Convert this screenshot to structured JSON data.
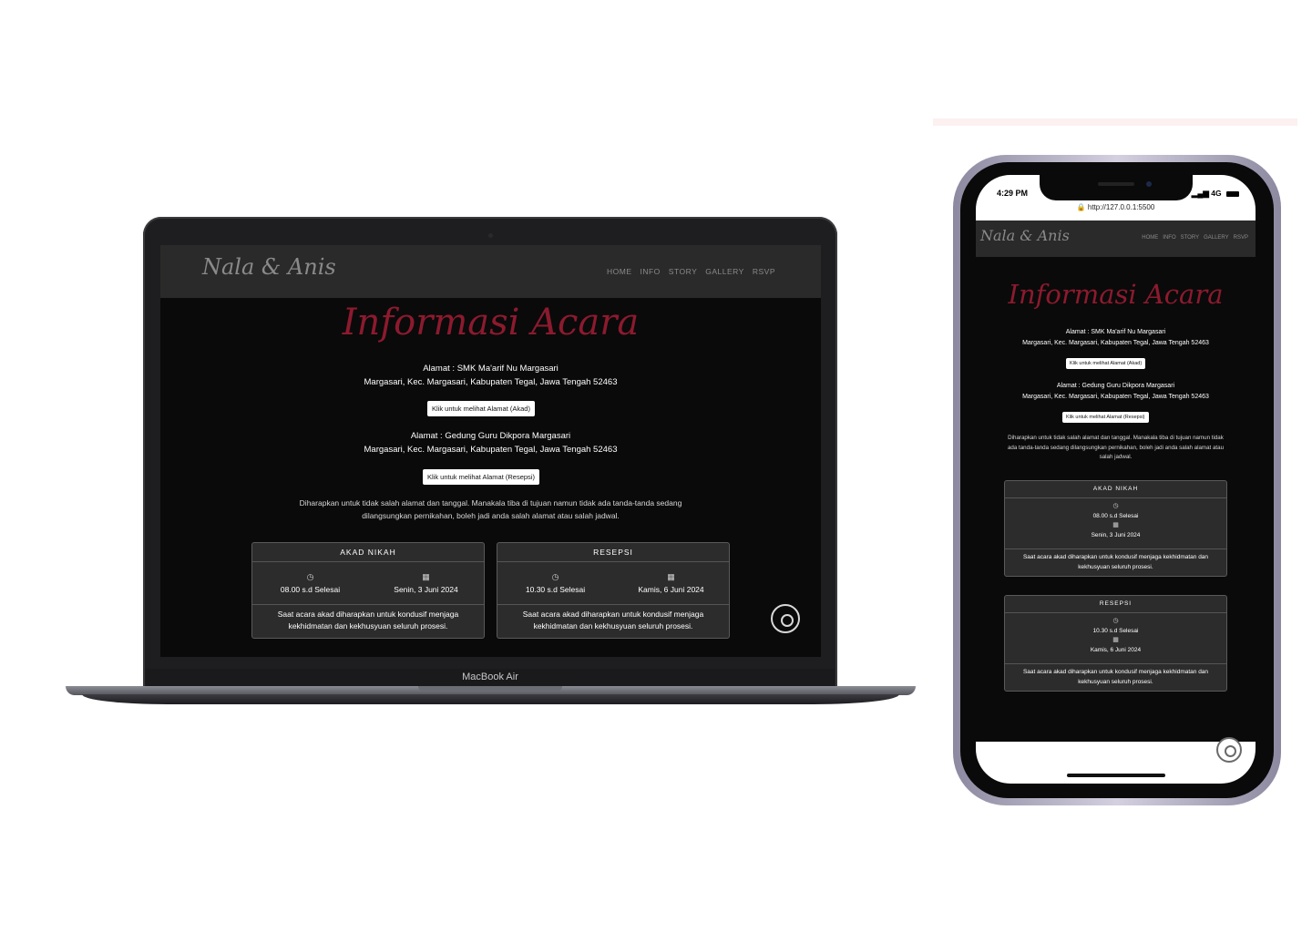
{
  "site": {
    "logo": "Nala & Anis",
    "nav": [
      "HOME",
      "INFO",
      "STORY",
      "GALLERY",
      "RSVP"
    ],
    "title": "Informasi Acara",
    "akad_address_line1": "Alamat : SMK Ma'arif Nu Margasari",
    "akad_address_line2": "Margasari, Kec. Margasari, Kabupaten Tegal, Jawa Tengah 52463",
    "akad_button": "Klik untuk melihat Alamat (Akad)",
    "resepsi_address_line1": "Alamat : Gedung Guru Dikpora Margasari",
    "resepsi_address_line2": "Margasari, Kec. Margasari, Kabupaten Tegal, Jawa Tengah 52463",
    "resepsi_button": "Klik untuk melihat Alamat (Resepsi)",
    "note": "Diharapkan untuk tidak salah alamat dan tanggal. Manakala tiba di tujuan namun tidak ada tanda-tanda sedang dilangsungkan pernikahan, boleh jadi anda salah alamat atau salah jadwal.",
    "cards": [
      {
        "title": "AKAD NIKAH",
        "time": "08.00 s.d Selesai",
        "date": "Senin, 3 Juni 2024",
        "desc": "Saat acara akad diharapkan untuk kondusif menjaga kekhidmatan dan kekhusyuan seluruh prosesi."
      },
      {
        "title": "RESEPSI",
        "time": "10.30 s.d Selesai",
        "date": "Kamis, 6 Juni 2024",
        "desc": "Saat acara akad diharapkan untuk kondusif menjaga kekhidmatan dan kekhusyuan seluruh prosesi."
      }
    ]
  },
  "laptop": {
    "brand": "MacBook Air"
  },
  "phone": {
    "time": "4:29 PM",
    "network": "4G",
    "url": "http://127.0.0.1:5500"
  },
  "icons": {
    "clock": "clock-icon",
    "calendar": "calendar-icon",
    "music": "music-disc-icon",
    "lock": "lock-icon"
  },
  "colors": {
    "title_accent": "#8c1a2e",
    "background": "#0a0a0a",
    "nav": "#2a2a2a",
    "card": "#2c2c2c"
  }
}
